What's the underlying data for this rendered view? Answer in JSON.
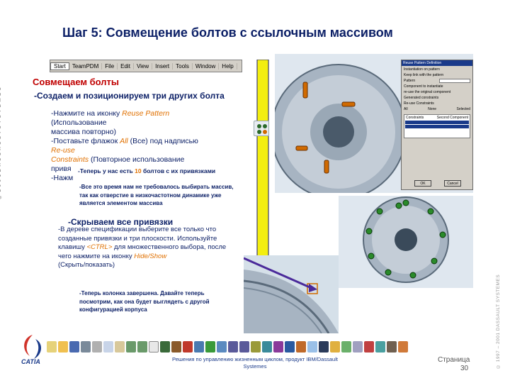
{
  "slide": {
    "title": "Шаг 5: Совмещение болтов с ссылочным массивом",
    "vertical_copyright_left": "© 2 0 0 1 D A S S A U L T S Y S T E M E S",
    "vertical_copyright_right": "© 1997 – 2001 DASSAULT SYSTEMES"
  },
  "menubar": {
    "items": [
      "Start",
      "TeamPDM",
      "File",
      "Edit",
      "View",
      "Insert",
      "Tools",
      "Window",
      "Help"
    ]
  },
  "content": {
    "subtitle": "Совмещаем болты",
    "lead": "-Создаем и позиционируем три других болта",
    "steps": {
      "line1": "-Нажмите на иконку ",
      "reuse_pattern": "Reuse Pattern",
      "line1b": " (Использование",
      "line2": " массива повторно)",
      "line3": "-Поставьте флажок ",
      "all": "All",
      "line3b": " (Все) под надписью ",
      "reuse": "Re-use",
      "constraints": " Constraints",
      "line4": " (Повторное использование",
      "line5": "привя",
      "line6": "-Нажм"
    },
    "note1_pre": "-Теперь у нас есть ",
    "note1_num": "10",
    "note1_post": " болтов с их привязками",
    "note2": "-Все это время нам не требовалось выбирать массив,\n так как отверстие в низкочастотном динамике уже\n является элементом массива",
    "subtitle_hide": "-Скрываем все привязки",
    "hide_steps": {
      "line1": "-В дереве спецификации выберите все только что",
      "line2": " созданные привязки и три плоскости. Используйте",
      "line3": " клавишу ",
      "ctrl": "<CTRL>",
      "line3b": " для множественного выбора, после",
      "line4": " чего нажмите на иконку ",
      "hide_show": "Hide/Show",
      "line5": "(Скрыть/показать)"
    },
    "note3": "-Теперь колонка завершена. Давайте теперь\n посмотрим, как она будет выглядеть с другой\n конфигурацией корпуса"
  },
  "dialog": {
    "title": "Reuse Pattern Definition",
    "rows": [
      "Instantiation on pattern",
      "Keep link with the pattern",
      "Pattern",
      "Component to instantiate",
      "Generated constraints"
    ],
    "field": "re-use the original component",
    "re_use_constraints_label": "Re-use Constraints",
    "options": [
      "All",
      "None",
      "Selected"
    ],
    "table_header": [
      "Constraints",
      "Second Component"
    ],
    "ok": "OK",
    "cancel": "Cancel"
  },
  "footer": {
    "line1": "Решения по управлению жизненным циклом, продукт IBM/Dassault",
    "line2": "Systemes",
    "page_label": "Страница",
    "page_number": "30"
  },
  "logo": {
    "text": "CATIA"
  },
  "colors": {
    "title": "#0b1f66",
    "subtitle_red": "#c00000",
    "accent_orange": "#e07000",
    "arrow_fill": "#f3ee10"
  }
}
